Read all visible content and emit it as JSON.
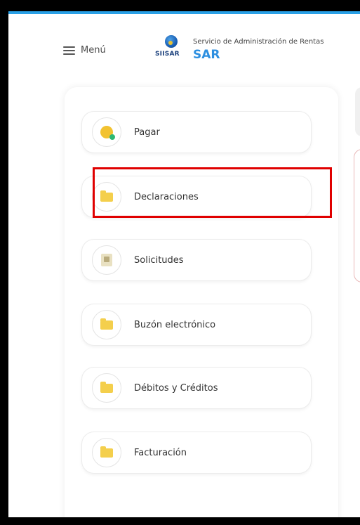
{
  "header": {
    "menu_label": "Menú",
    "logo_text": "SIISAR",
    "org_name": "Servicio de Administración de Rentas",
    "org_abbr": "SAR"
  },
  "nav": {
    "items": [
      {
        "label": "Pagar",
        "icon": "coin-icon"
      },
      {
        "label": "Declaraciones",
        "icon": "folder-icon"
      },
      {
        "label": "Solicitudes",
        "icon": "request-icon"
      },
      {
        "label": "Buzón electrónico",
        "icon": "folder-icon"
      },
      {
        "label": "Débitos y Créditos",
        "icon": "folder-icon"
      },
      {
        "label": "Facturación",
        "icon": "folder-icon"
      }
    ]
  },
  "colors": {
    "accent": "#2d8fe0",
    "highlight": "#e00000",
    "folder": "#f4cf4c"
  }
}
